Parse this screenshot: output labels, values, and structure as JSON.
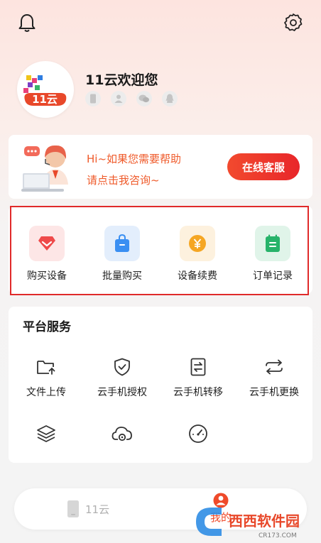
{
  "header": {
    "bell_icon": "bell-icon",
    "settings_icon": "gear-icon"
  },
  "profile": {
    "avatar_logo_text": "11云",
    "username": "11云欢迎您",
    "bindings": [
      "phone-icon",
      "user-icon",
      "wechat-icon",
      "qq-icon"
    ]
  },
  "help": {
    "line1": "Hi~如果您需要帮助",
    "line2": "请点击我咨询~",
    "button_label": "在线客服"
  },
  "quick_actions": [
    {
      "label": "购买设备",
      "icon": "diamond-icon",
      "color": "#ef4a4a"
    },
    {
      "label": "批量购买",
      "icon": "shopping-bag-icon",
      "color": "#3a8ff2"
    },
    {
      "label": "设备续费",
      "icon": "yen-coin-icon",
      "color": "#f5a623"
    },
    {
      "label": "订单记录",
      "icon": "notebook-icon",
      "color": "#27b36a"
    }
  ],
  "platform": {
    "title": "平台服务",
    "items": [
      {
        "label": "文件上传",
        "icon": "folder-upload-icon"
      },
      {
        "label": "云手机授权",
        "icon": "shield-check-icon"
      },
      {
        "label": "云手机转移",
        "icon": "transfer-icon"
      },
      {
        "label": "云手机更换",
        "icon": "swap-icon"
      },
      {
        "label": "",
        "icon": "layers-icon"
      },
      {
        "label": "",
        "icon": "cloud-gear-icon"
      },
      {
        "label": "",
        "icon": "speedometer-icon"
      }
    ]
  },
  "bottom_nav": {
    "tab_cloud": "11云",
    "tab_mine": "我的"
  },
  "watermark": {
    "text": "西西软件园",
    "url_text": "CR173.COM"
  }
}
